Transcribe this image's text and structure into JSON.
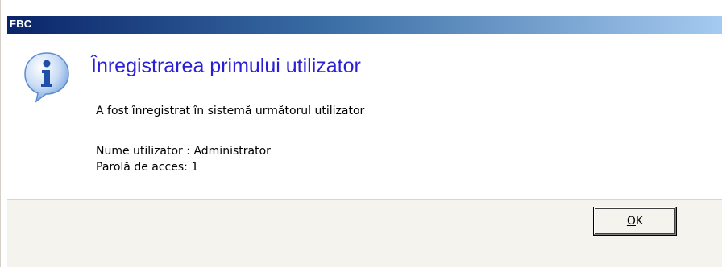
{
  "window": {
    "title": "FBC"
  },
  "dialog": {
    "icon": "information-icon",
    "heading": "Înregistrarea primului utilizator",
    "message": "A fost înregistrat în sistemă următorul utilizator",
    "fields": [
      {
        "label": "Nume utilizator",
        "separator": " : ",
        "value": "Administrator"
      },
      {
        "label": "Parolă de acces",
        "separator": ": ",
        "value": "1"
      }
    ]
  },
  "buttons": {
    "ok_mnemonic": "O",
    "ok_rest": "K"
  },
  "colors": {
    "heading": "#2b1fd6",
    "titlebar_start": "#0a246a",
    "titlebar_end": "#a6caf0",
    "footer_bg": "#f4f3ee"
  }
}
